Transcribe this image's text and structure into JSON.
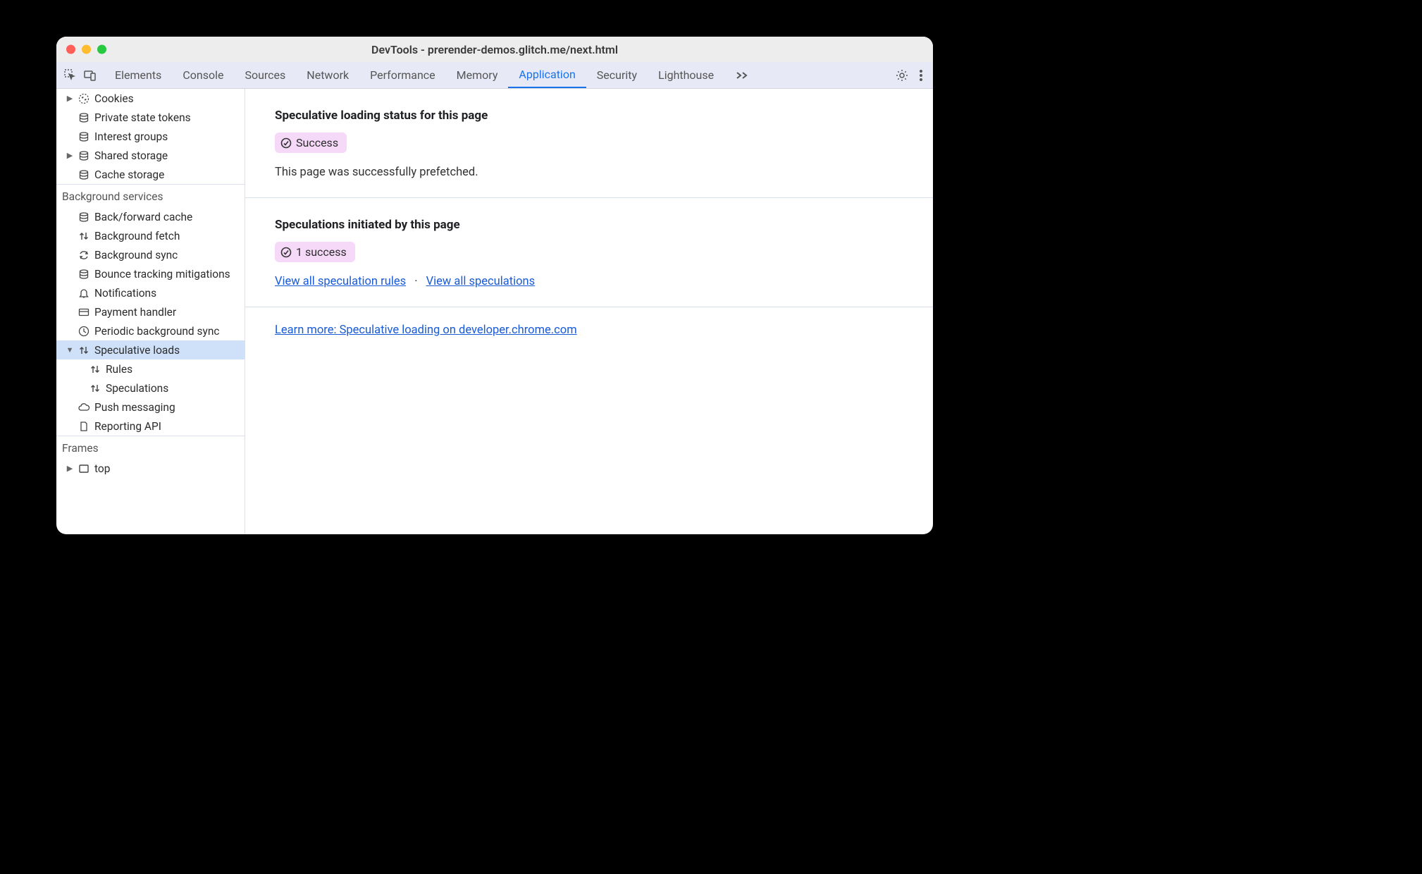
{
  "window": {
    "title": "DevTools - prerender-demos.glitch.me/next.html"
  },
  "toolbar": {
    "tabs": [
      "Elements",
      "Console",
      "Sources",
      "Network",
      "Performance",
      "Memory",
      "Application",
      "Security",
      "Lighthouse"
    ],
    "active_tab": "Application"
  },
  "sidebar": {
    "storage_items": [
      {
        "label": "Cookies",
        "icon": "cookie",
        "expandable": true
      },
      {
        "label": "Private state tokens",
        "icon": "db"
      },
      {
        "label": "Interest groups",
        "icon": "db"
      },
      {
        "label": "Shared storage",
        "icon": "db",
        "expandable": true
      },
      {
        "label": "Cache storage",
        "icon": "db"
      }
    ],
    "bg_header": "Background services",
    "bg_items": [
      {
        "label": "Back/forward cache",
        "icon": "db"
      },
      {
        "label": "Background fetch",
        "icon": "updown"
      },
      {
        "label": "Background sync",
        "icon": "sync"
      },
      {
        "label": "Bounce tracking mitigations",
        "icon": "db"
      },
      {
        "label": "Notifications",
        "icon": "bell"
      },
      {
        "label": "Payment handler",
        "icon": "card"
      },
      {
        "label": "Periodic background sync",
        "icon": "clock"
      },
      {
        "label": "Speculative loads",
        "icon": "updown",
        "expandable": true,
        "expanded": true,
        "selected": true,
        "children": [
          {
            "label": "Rules",
            "icon": "updown"
          },
          {
            "label": "Speculations",
            "icon": "updown"
          }
        ]
      },
      {
        "label": "Push messaging",
        "icon": "cloud"
      },
      {
        "label": "Reporting API",
        "icon": "doc"
      }
    ],
    "frames_header": "Frames",
    "frames_items": [
      {
        "label": "top",
        "icon": "frame",
        "expandable": true
      }
    ]
  },
  "panel": {
    "status_heading": "Speculative loading status for this page",
    "status_badge": "Success",
    "status_text": "This page was successfully prefetched.",
    "initiated_heading": "Speculations initiated by this page",
    "initiated_badge": "1 success",
    "link_rules": "View all speculation rules",
    "link_speculations": "View all speculations",
    "learn_more": "Learn more: Speculative loading on developer.chrome.com"
  }
}
